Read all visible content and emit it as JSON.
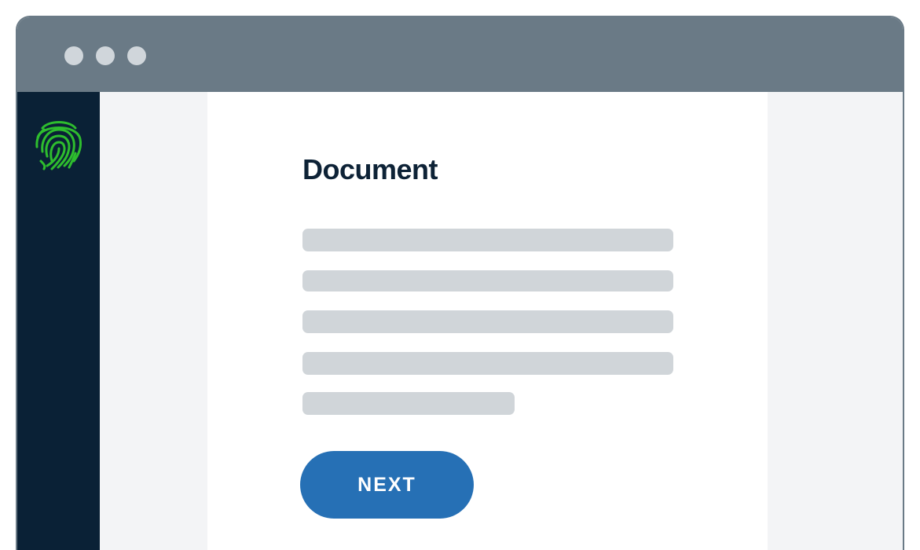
{
  "window": {
    "controls": [
      "dot",
      "dot",
      "dot"
    ]
  },
  "sidebar": {
    "logo_icon": "fingerprint-icon",
    "logo_color": "#2ebd2e"
  },
  "main": {
    "title": "Document",
    "placeholder_lines": 5,
    "next_label": "NEXT"
  },
  "colors": {
    "titlebar": "#6a7a86",
    "sidebar": "#0a2136",
    "accent": "#2670b5",
    "placeholder": "#d0d5d9"
  }
}
